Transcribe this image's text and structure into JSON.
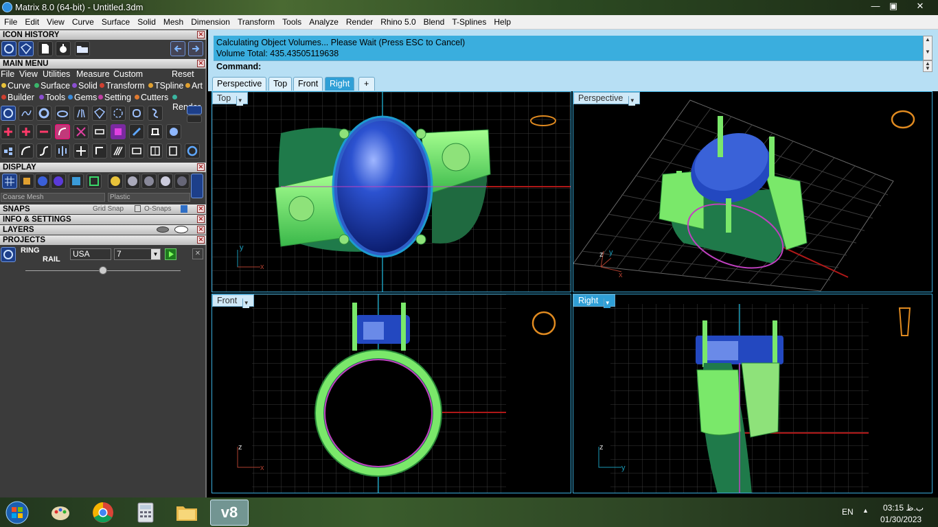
{
  "window": {
    "title": "Matrix 8.0 (64-bit) - Untitled.3dm",
    "controls": [
      "—",
      "▣",
      "✕"
    ]
  },
  "menubar": [
    "File",
    "Edit",
    "View",
    "Curve",
    "Surface",
    "Solid",
    "Mesh",
    "Dimension",
    "Transform",
    "Tools",
    "Analyze",
    "Render",
    "Rhino 5.0",
    "Blend",
    "T-Splines",
    "Help"
  ],
  "panels": {
    "icon_history": "ICON HISTORY",
    "main_menu": "MAIN MENU",
    "main_menu_links": [
      "File",
      "View",
      "Utilities",
      "Measure",
      "Custom"
    ],
    "reset": "Reset",
    "categories_row1": [
      "Curve",
      "Surface",
      "Solid",
      "Transform",
      "TSpline",
      "Art"
    ],
    "categories_row2": [
      "Builder",
      "Tools",
      "Gems",
      "Setting",
      "Cutters",
      "Render"
    ],
    "display": "DISPLAY",
    "display_mesh": "Coarse Mesh",
    "display_material": "Plastic",
    "snaps": "SNAPS",
    "grid_snap": "Grid Snap",
    "o_snaps": "O-Snaps",
    "info": "INFO & SETTINGS",
    "layers": "LAYERS",
    "projects": "PROJECTS",
    "ring_label": "RING",
    "rail_label": "RAIL",
    "ring_size_system": "USA",
    "ring_size": "7"
  },
  "command": {
    "line1": "Calculating Object Volumes... Please Wait (Press ESC to Cancel)",
    "line2": "Volume Total: 435.43505119638",
    "prompt": "Command:"
  },
  "tabs": [
    "Perspective",
    "Top",
    "Front",
    "Right",
    "+"
  ],
  "active_tab": "Right",
  "viewports": {
    "top": {
      "label": "Top",
      "axis_a": "y",
      "axis_b": "x"
    },
    "perspective": {
      "label": "Perspective",
      "axis_a": "z",
      "axis_b": "y",
      "axis_c": "x"
    },
    "front": {
      "label": "Front",
      "axis_a": "z",
      "axis_b": "x"
    },
    "right": {
      "label": "Right",
      "axis_a": "z",
      "axis_b": "y"
    }
  },
  "colors": {
    "accent": "#2f9fd6",
    "command_bg": "#3aaede",
    "metal": "#7ae86a",
    "metal_dark": "#1f7a4a",
    "stone": "#1e3fb0",
    "axis_red": "#c01818",
    "axis_cyan": "#1a9ab8"
  },
  "taskbar": {
    "apps": [
      "start",
      "paint",
      "chrome",
      "calculator",
      "explorer",
      "matrix"
    ],
    "active_app_label": "v8",
    "language": "EN",
    "time": "03:15 ب.ظ",
    "date": "01/30/2023"
  }
}
